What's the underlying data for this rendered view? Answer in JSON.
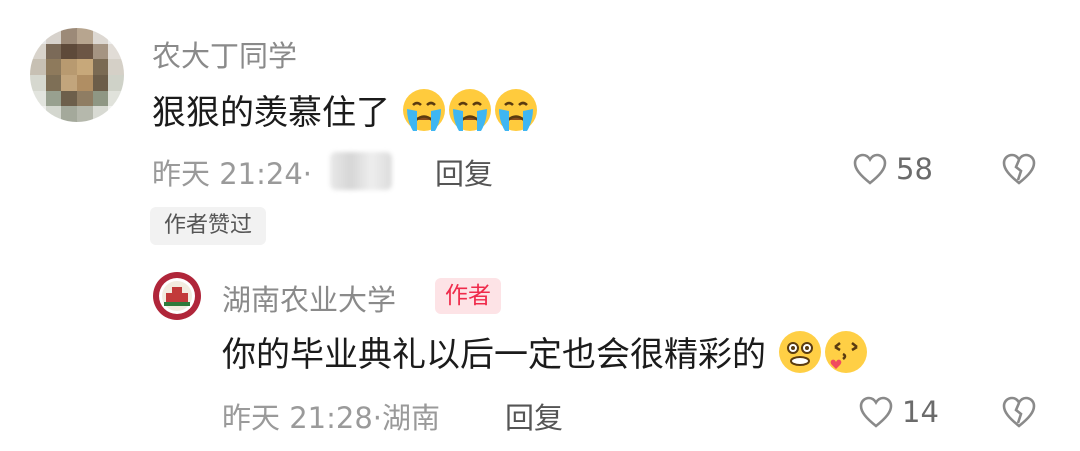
{
  "comment": {
    "username": "农大丁同学",
    "text": "狠狠的羡慕住了",
    "emojis": [
      "crying-face",
      "crying-face",
      "crying-face"
    ],
    "time": "昨天 21:24·",
    "reply_label": "回复",
    "like_count": "58",
    "liked_by_author_label": "作者赞过"
  },
  "reply": {
    "username": "湖南农业大学",
    "badge": "作者",
    "text": "你的毕业典礼以后一定也会很精彩的",
    "emojis": [
      "silly-face",
      "kissing-face"
    ],
    "time": "昨天 21:28·湖南",
    "reply_label": "回复",
    "like_count": "14"
  },
  "colors": {
    "badge_red": "#ef2b4b",
    "badge_bg": "#fde3e6",
    "meta_gray": "#9a9a9a"
  }
}
